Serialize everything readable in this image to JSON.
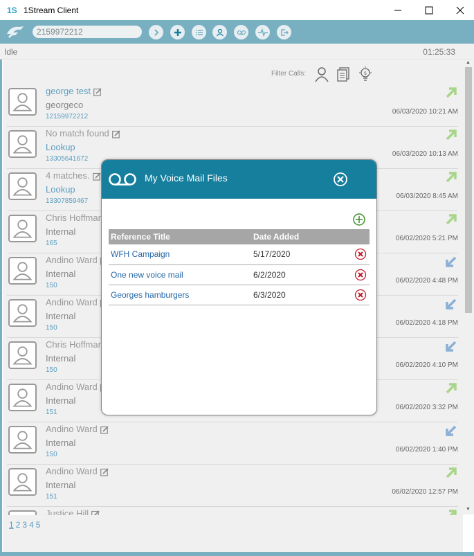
{
  "window": {
    "logo_text": "1S",
    "title": "1Stream Client"
  },
  "toolbar": {
    "number_value": "2159972212"
  },
  "status": {
    "state": "Idle",
    "timer": "01:25:33"
  },
  "filter": {
    "label": "Filter Calls:"
  },
  "calls": [
    {
      "name": "george test",
      "sub": "georgeco",
      "number": "12159972212",
      "date": "06/03/2020 10:21 AM",
      "direction": "outbound"
    },
    {
      "name": "No match found",
      "sub": "Lookup",
      "number": "13305641672",
      "date": "06/03/2020 10:13 AM",
      "direction": "outbound"
    },
    {
      "name": "4 matches.",
      "sub": "Lookup",
      "number": "13307859467",
      "date": "06/03/2020 8:45 AM",
      "direction": "outbound"
    },
    {
      "name": "Chris Hoffman",
      "sub": "Internal",
      "number": "165",
      "date": "06/02/2020 5:21 PM",
      "direction": "outbound"
    },
    {
      "name": "Andino Ward",
      "sub": "Internal",
      "number": "150",
      "date": "06/02/2020 4:48 PM",
      "direction": "inbound"
    },
    {
      "name": "Andino Ward",
      "sub": "Internal",
      "number": "150",
      "date": "06/02/2020 4:18 PM",
      "direction": "inbound"
    },
    {
      "name": "Chris Hoffman",
      "sub": "Internal",
      "number": "150",
      "date": "06/02/2020 4:10 PM",
      "direction": "inbound"
    },
    {
      "name": "Andino Ward",
      "sub": "Internal",
      "number": "151",
      "date": "06/02/2020 3:32 PM",
      "direction": "outbound"
    },
    {
      "name": "Andino Ward",
      "sub": "Internal",
      "number": "150",
      "date": "06/02/2020 1:40 PM",
      "direction": "inbound"
    },
    {
      "name": "Andino Ward",
      "sub": "Internal",
      "number": "151",
      "date": "06/02/2020 12:57 PM",
      "direction": "outbound"
    },
    {
      "name": "Justice Hill",
      "sub": "",
      "number": "",
      "date": "",
      "direction": "outbound"
    }
  ],
  "pagination": [
    "1",
    "2",
    "3",
    "4",
    "5"
  ],
  "modal": {
    "title": "My Voice Mail Files",
    "columns": {
      "reference": "Reference Title",
      "date": "Date Added"
    },
    "rows": [
      {
        "title": "WFH Campaign",
        "date": "5/17/2020"
      },
      {
        "title": "One new voice mail",
        "date": "6/2/2020"
      },
      {
        "title": "Georges hamburgers",
        "date": "6/3/2020"
      }
    ]
  },
  "colors": {
    "accent": "#78b0c2",
    "modal_header": "#167f9e",
    "link": "#5b9ec0",
    "outbound_arrow": "#a9d58a",
    "inbound_arrow": "#8bb0d6",
    "delete": "#c0192a",
    "add": "#3f8d2b"
  }
}
